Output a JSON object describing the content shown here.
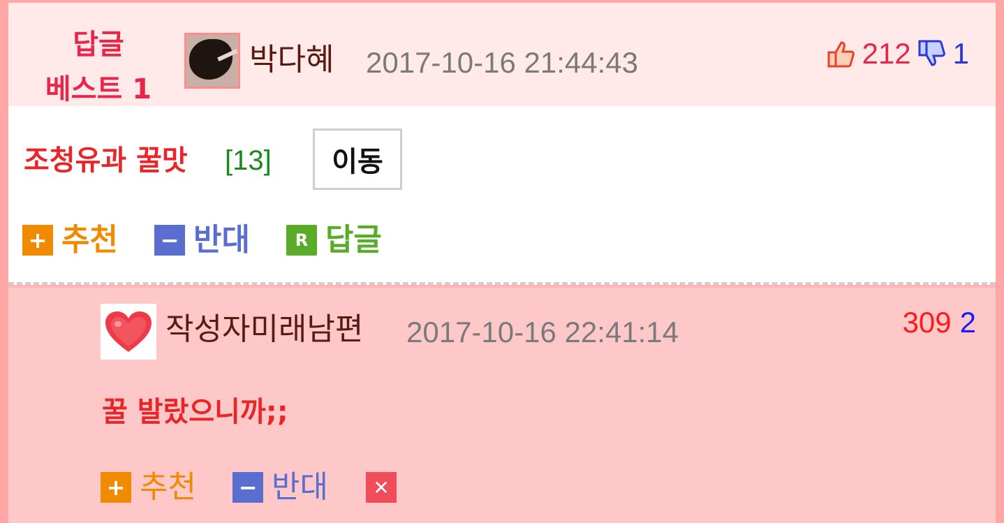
{
  "best_header": {
    "label_line1": "답글",
    "label_line2": "베스트 1",
    "username": "박다혜",
    "date": "2017-10-16 21:44:43",
    "up_count": "212",
    "down_count": "1"
  },
  "best_body": {
    "title": "조청유과 꿀맛",
    "comment_count": "[13]",
    "move_button": "이동",
    "actions": {
      "recommend": "추천",
      "oppose": "반대",
      "reply": "답글"
    }
  },
  "reply": {
    "username": "작성자미래남편",
    "date": "2017-10-16 22:41:14",
    "up_count": "309",
    "down_count": "2",
    "text": "꿀 발랐으니까;;",
    "actions": {
      "recommend": "추천",
      "oppose": "반대"
    }
  },
  "colors": {
    "accent_red": "#e8264a",
    "recommend_orange": "#f08a00",
    "oppose_blue": "#5a6ed0",
    "reply_green": "#5aab2a",
    "reply_bg": "#ffc8c8",
    "header_bg": "#ffe9e9"
  },
  "icons": {
    "thumbs_up": "thumbs-up-icon",
    "thumbs_down": "thumbs-down-icon",
    "heart": "heart-icon",
    "plus": "plus-icon",
    "minus": "minus-icon",
    "reply": "reply-r-icon",
    "delete": "close-icon"
  }
}
